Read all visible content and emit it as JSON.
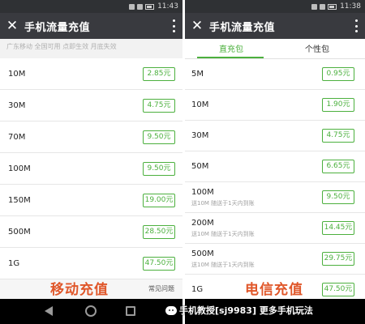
{
  "colors": {
    "accent": "#4cb03e",
    "appbar": "#393a3f",
    "caption": "#e0572a"
  },
  "left": {
    "status_time": "11:43",
    "title": "手机流量充值",
    "close_icon": "close-icon",
    "menu_icon": "more-vertical-icon",
    "subtitle": "广东移动 全国可用 点即生效 月底失效",
    "items": [
      {
        "amount": "10M",
        "price": "2.85元"
      },
      {
        "amount": "30M",
        "price": "4.75元"
      },
      {
        "amount": "70M",
        "price": "9.50元"
      },
      {
        "amount": "100M",
        "price": "9.50元"
      },
      {
        "amount": "150M",
        "price": "19.00元"
      },
      {
        "amount": "500M",
        "price": "28.50元"
      },
      {
        "amount": "1G",
        "price": "47.50元"
      }
    ],
    "faq": "常见问题",
    "caption": "移动充值"
  },
  "right": {
    "status_time": "11:38",
    "title": "手机流量充值",
    "tabs": [
      "直充包",
      "个性包"
    ],
    "items": [
      {
        "amount": "5M",
        "price": "0.95元",
        "note": ""
      },
      {
        "amount": "10M",
        "price": "1.90元",
        "note": ""
      },
      {
        "amount": "30M",
        "price": "4.75元",
        "note": ""
      },
      {
        "amount": "50M",
        "price": "6.65元",
        "note": ""
      },
      {
        "amount": "100M",
        "price": "9.50元",
        "note": "送10M 随送于1天内到账"
      },
      {
        "amount": "200M",
        "price": "14.45元",
        "note": "送10M 随送于1天内到账"
      },
      {
        "amount": "500M",
        "price": "29.75元",
        "note": "送10M 随送于1天内到账"
      },
      {
        "amount": "1G",
        "price": "47.50元",
        "note": ""
      }
    ],
    "caption": "电信充值"
  },
  "watermark": "手机教授[sj9983] 更多手机玩法",
  "nav": {
    "back_icon": "back-icon",
    "home_icon": "home-icon",
    "recent_icon": "recent-apps-icon"
  }
}
